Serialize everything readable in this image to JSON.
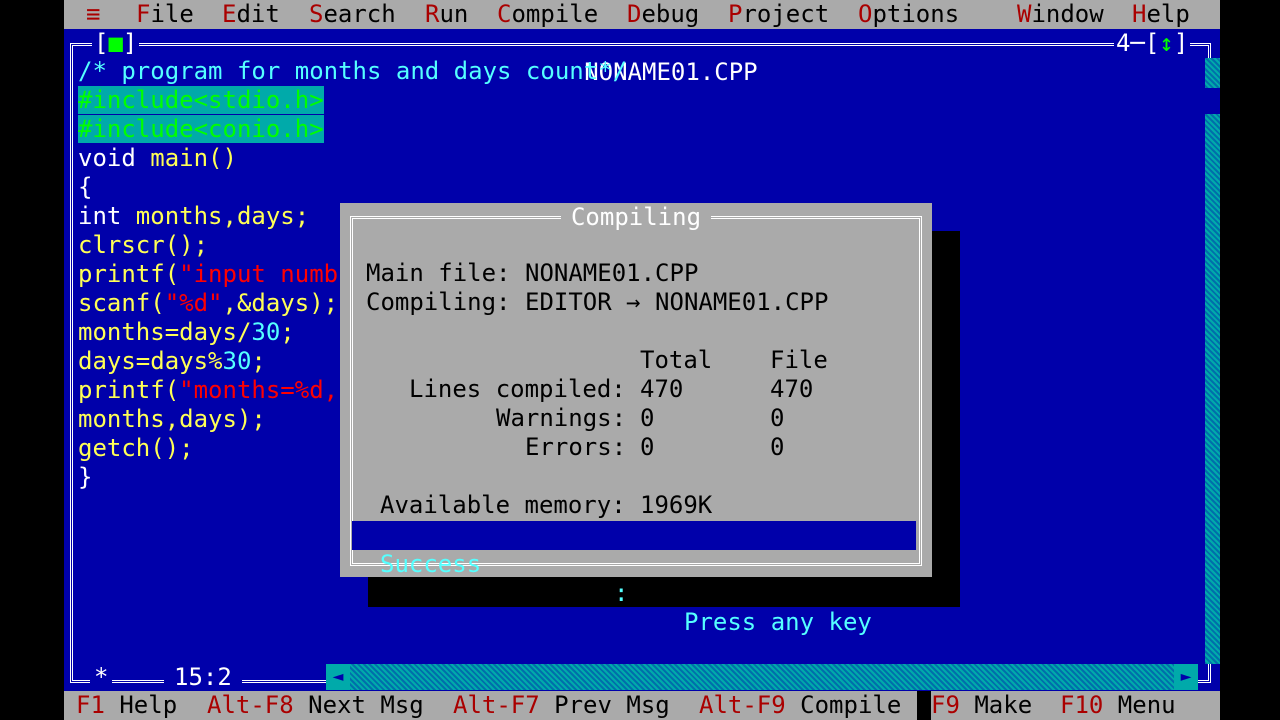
{
  "menubar": {
    "system_glyph": "≡",
    "items": [
      {
        "hotkey": "F",
        "rest": "ile"
      },
      {
        "hotkey": "E",
        "rest": "dit"
      },
      {
        "hotkey": "S",
        "rest": "earch"
      },
      {
        "hotkey": "R",
        "rest": "un"
      },
      {
        "hotkey": "C",
        "rest": "ompile"
      },
      {
        "hotkey": "D",
        "rest": "ebug"
      },
      {
        "hotkey": "P",
        "rest": "roject"
      },
      {
        "hotkey": "O",
        "rest": "ptions"
      },
      {
        "hotkey": "W",
        "rest": "indow"
      },
      {
        "hotkey": "H",
        "rest": "elp"
      }
    ]
  },
  "window": {
    "title": "NONAME01.CPP",
    "close_box_glyph": "■",
    "number": "4",
    "zoom_glyph": "↕",
    "cursor_pos": "15:2",
    "star": "*"
  },
  "code": {
    "comment": "/* program for months and days count*/",
    "include1": "#include<stdio.h>",
    "include2": "#include<conio.h>",
    "l_void": "void ",
    "l_main": "main()",
    "brace_open": "{",
    "l_int": "int ",
    "l_int_vars": "months,days;",
    "l_clrscr": "clrscr();",
    "l_printf1": "printf(",
    "l_printf1_str": "\"input numb",
    "l_scanf": "scanf(",
    "l_scanf_str": "\"%d\"",
    "l_scanf_rest": ",&days);",
    "l_months": "months=days/",
    "l_months_num": "30",
    "l_months_end": ";",
    "l_days": "days=days%",
    "l_days_num": "30",
    "l_days_end": ";",
    "l_printf2": "printf(",
    "l_printf2_str": "\"months=%d,",
    "l_args": "months,days);",
    "l_getch": "getch();",
    "brace_close": "}"
  },
  "dialog": {
    "title": "Compiling",
    "main_file_label": "Main file:",
    "main_file": "NONAME01.CPP",
    "compiling_label": "Compiling:",
    "compiling_value": "EDITOR → NONAME01.CPP",
    "col_total": "Total",
    "col_file": "File",
    "lines_label": "Lines compiled:",
    "lines_total": "470",
    "lines_file": "470",
    "warnings_label": "Warnings:",
    "warnings_total": "0",
    "warnings_file": "0",
    "errors_label": "Errors:",
    "errors_total": "0",
    "errors_file": "0",
    "memory_label": "Available memory:",
    "memory_value": "1969K",
    "status": "Success",
    "status_sep": ":",
    "status_msg": "Press any key"
  },
  "statusbar": {
    "items": [
      {
        "key": "F1",
        "label": " Help"
      },
      {
        "key": "Alt-F8",
        "label": " Next Msg"
      },
      {
        "key": "Alt-F7",
        "label": " Prev Msg"
      },
      {
        "key": "Alt-F9",
        "label": " Compile"
      },
      {
        "key": "F9",
        "label": " Make"
      },
      {
        "key": "F10",
        "label": " Menu"
      }
    ]
  },
  "colors": {
    "background": "#0000aa",
    "menubar": "#aaaaaa",
    "hotkey": "#aa0000",
    "dialog": "#aaaaaa",
    "status_bar_highlight": "#0000aa"
  }
}
